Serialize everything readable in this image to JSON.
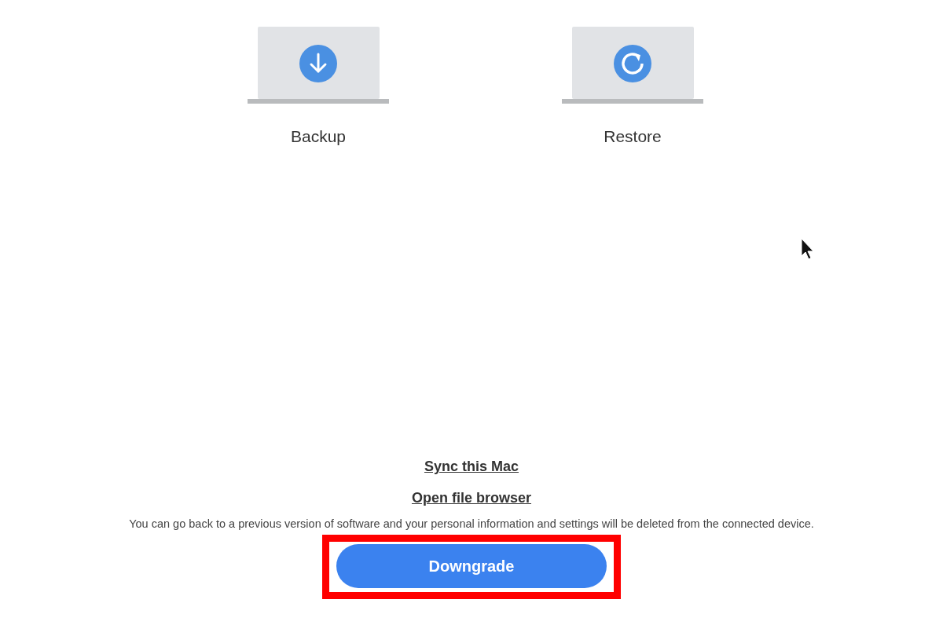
{
  "options": [
    {
      "kind": "backup",
      "label": "Backup"
    },
    {
      "kind": "restore",
      "label": "Restore"
    }
  ],
  "links": [
    "Sync this Mac",
    "Open file browser"
  ],
  "notice": "You can go back to a previous version of software and your personal information and settings will be deleted from the connected device.",
  "primary_button": {
    "label": "Downgrade",
    "highlighted": true
  }
}
